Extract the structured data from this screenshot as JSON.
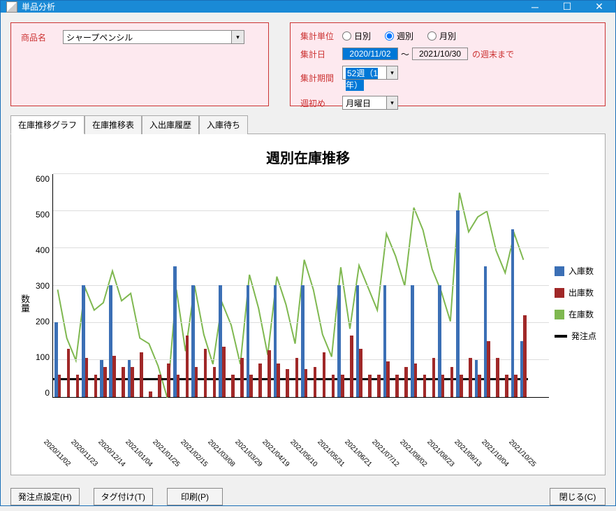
{
  "window": {
    "title": "単品分析"
  },
  "form": {
    "product_label": "商品名",
    "product_value": "シャープペンシル",
    "unit_label": "集計単位",
    "unit_options": {
      "daily": "日別",
      "weekly": "週別",
      "monthly": "月別"
    },
    "unit_selected": "weekly",
    "date_label": "集計日",
    "date_from": "2020/11/02",
    "date_to": "2021/10/30",
    "date_sep": "～",
    "date_suffix": "の週末まで",
    "period_label": "集計期間",
    "period_value": "52週（1年）",
    "weekstart_label": "週初め",
    "weekstart_value": "月曜日"
  },
  "tabs": [
    "在庫推移グラフ",
    "在庫推移表",
    "入出庫履歴",
    "入庫待ち"
  ],
  "legend": {
    "in": "入庫数",
    "out": "出庫数",
    "stock": "在庫数",
    "reorder": "発注点"
  },
  "yaxis_label": "数量",
  "footer": {
    "reorder": "発注点設定(H)",
    "tag": "タグ付け(T)",
    "print": "印刷(P)",
    "close": "閉じる(C)"
  },
  "chart_data": {
    "type": "bar+line",
    "title": "週別在庫推移",
    "ylabel": "数量",
    "ylim": [
      0,
      600
    ],
    "yticks": [
      0,
      100,
      200,
      300,
      400,
      500,
      600
    ],
    "reorder_point": 50,
    "categories": [
      "2020/11/02",
      "2020/11/09",
      "2020/11/16",
      "2020/11/23",
      "2020/11/30",
      "2020/12/07",
      "2020/12/14",
      "2020/12/21",
      "2020/12/28",
      "2021/01/04",
      "2021/01/11",
      "2021/01/18",
      "2021/01/25",
      "2021/02/01",
      "2021/02/08",
      "2021/02/15",
      "2021/02/22",
      "2021/03/01",
      "2021/03/08",
      "2021/03/15",
      "2021/03/22",
      "2021/03/29",
      "2021/04/05",
      "2021/04/12",
      "2021/04/19",
      "2021/04/26",
      "2021/05/03",
      "2021/05/10",
      "2021/05/17",
      "2021/05/24",
      "2021/05/31",
      "2021/06/07",
      "2021/06/14",
      "2021/06/21",
      "2021/06/28",
      "2021/07/05",
      "2021/07/12",
      "2021/07/19",
      "2021/07/26",
      "2021/08/02",
      "2021/08/09",
      "2021/08/16",
      "2021/08/23",
      "2021/08/30",
      "2021/09/06",
      "2021/09/13",
      "2021/09/20",
      "2021/09/27",
      "2021/10/04",
      "2021/10/11",
      "2021/10/18",
      "2021/10/25"
    ],
    "xtick_labels": [
      "2020/11/02",
      "2020/11/23",
      "2020/12/14",
      "2021/01/04",
      "2021/01/25",
      "2021/02/15",
      "2021/03/08",
      "2021/03/29",
      "2021/04/19",
      "2021/05/10",
      "2021/05/31",
      "2021/06/21",
      "2021/07/12",
      "2021/08/02",
      "2021/08/23",
      "2021/09/13",
      "2021/10/04",
      "2021/10/25"
    ],
    "series": [
      {
        "name": "入庫数",
        "type": "bar",
        "color": "#3b6fb5",
        "values": [
          200,
          0,
          0,
          300,
          0,
          100,
          300,
          0,
          100,
          0,
          0,
          0,
          0,
          350,
          0,
          300,
          0,
          0,
          300,
          0,
          0,
          300,
          0,
          0,
          300,
          0,
          0,
          300,
          0,
          0,
          0,
          300,
          0,
          300,
          0,
          0,
          300,
          0,
          0,
          300,
          0,
          0,
          300,
          0,
          500,
          0,
          100,
          350,
          0,
          0,
          450,
          150
        ]
      },
      {
        "name": "出庫数",
        "type": "bar",
        "color": "#a02828",
        "values": [
          60,
          130,
          60,
          105,
          60,
          80,
          110,
          80,
          80,
          120,
          15,
          60,
          90,
          60,
          165,
          80,
          130,
          80,
          135,
          60,
          105,
          60,
          90,
          125,
          90,
          75,
          105,
          75,
          80,
          120,
          60,
          60,
          165,
          130,
          60,
          60,
          95,
          60,
          80,
          90,
          60,
          105,
          60,
          80,
          60,
          105,
          60,
          150,
          105,
          60,
          60,
          220
        ]
      },
      {
        "name": "在庫数",
        "type": "line",
        "color": "#7fb850",
        "values": [
          290,
          160,
          100,
          295,
          235,
          255,
          340,
          260,
          280,
          160,
          145,
          85,
          0,
          290,
          125,
          300,
          170,
          90,
          255,
          195,
          90,
          330,
          240,
          115,
          325,
          250,
          145,
          370,
          290,
          170,
          110,
          350,
          185,
          355,
          295,
          235,
          440,
          380,
          300,
          510,
          450,
          345,
          285,
          205,
          550,
          445,
          485,
          500,
          395,
          335,
          440,
          370
        ]
      },
      {
        "name": "発注点",
        "type": "hline",
        "color": "#000",
        "value": 50
      }
    ]
  }
}
